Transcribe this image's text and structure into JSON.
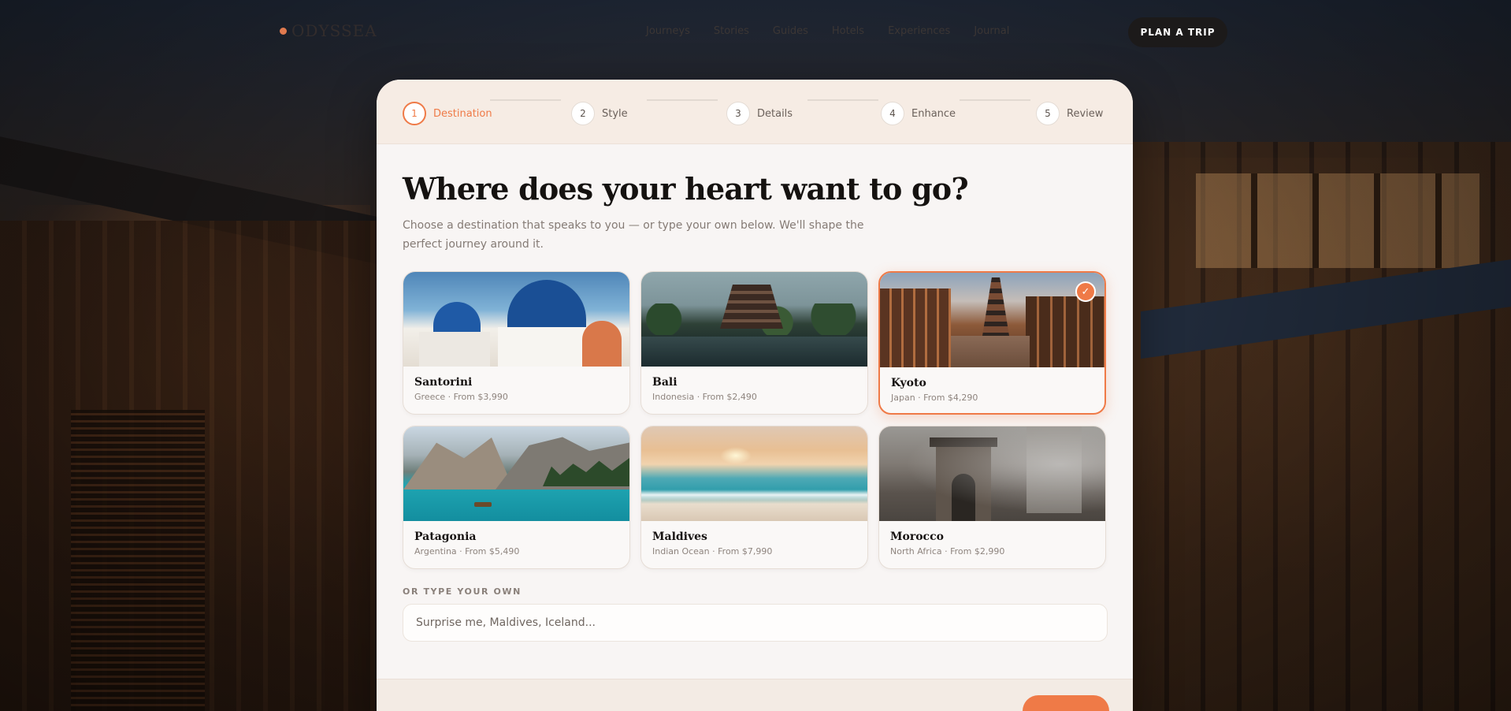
{
  "nav": {
    "logo": "ODYSSEA",
    "links": [
      "Journeys",
      "Stories",
      "Guides",
      "Hotels",
      "Experiences",
      "Journal"
    ],
    "cta": "PLAN A TRIP"
  },
  "stepper": {
    "steps": [
      {
        "num": "1",
        "label": "Destination",
        "active": true
      },
      {
        "num": "2",
        "label": "Style",
        "active": false
      },
      {
        "num": "3",
        "label": "Details",
        "active": false
      },
      {
        "num": "4",
        "label": "Enhance",
        "active": false
      },
      {
        "num": "5",
        "label": "Review",
        "active": false
      }
    ]
  },
  "main": {
    "heading": "Where does your heart want to go?",
    "subheading": "Choose a destination that speaks to you — or type your own below. We'll shape the perfect journey around it.",
    "destinations": [
      {
        "name": "Santorini",
        "meta": "Greece · From $3,990",
        "selected": false
      },
      {
        "name": "Bali",
        "meta": "Indonesia · From $2,490",
        "selected": false
      },
      {
        "name": "Kyoto",
        "meta": "Japan · From $4,290",
        "selected": true
      },
      {
        "name": "Patagonia",
        "meta": "Argentina · From $5,490",
        "selected": false
      },
      {
        "name": "Maldives",
        "meta": "Indian Ocean · From $7,990",
        "selected": false
      },
      {
        "name": "Morocco",
        "meta": "North Africa · From $2,990",
        "selected": false
      }
    ],
    "custom": {
      "label": "OR TYPE YOUR OWN",
      "placeholder": "Surprise me, Maldives, Iceland...",
      "value": ""
    }
  },
  "colors": {
    "accent": "#ef7a47",
    "dark": "#1c1a1a"
  }
}
